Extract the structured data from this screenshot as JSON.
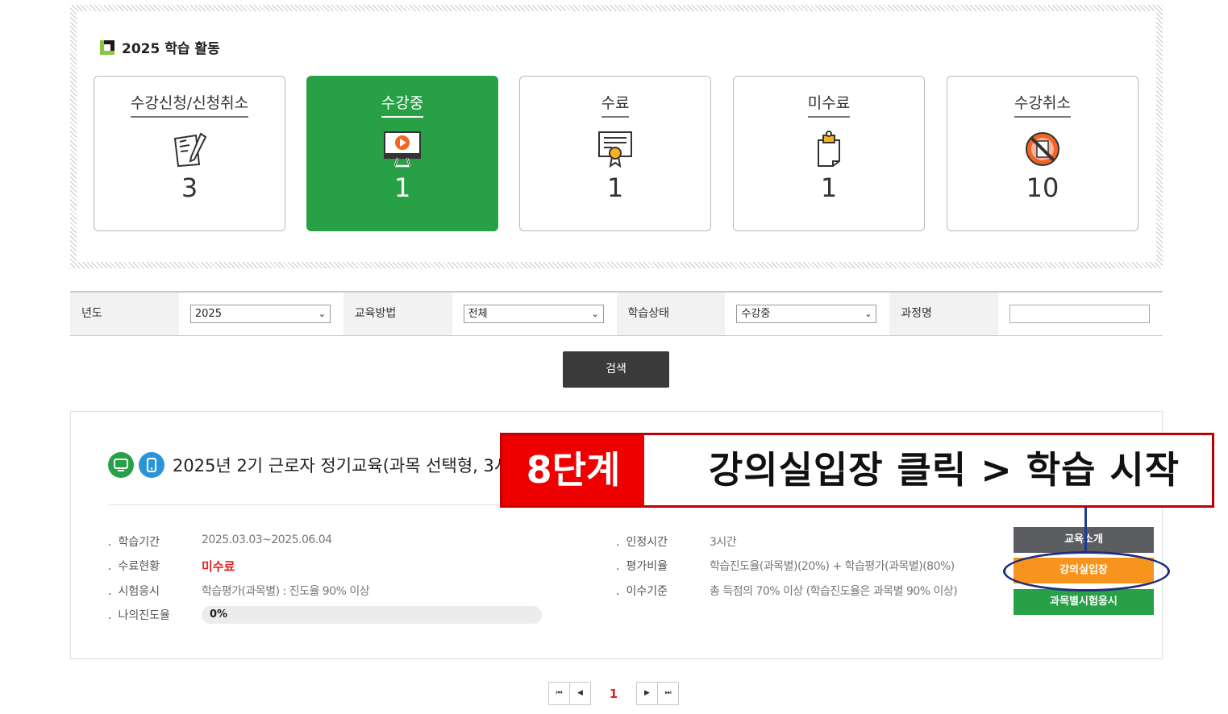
{
  "summary": {
    "title": "2025 학습 활동",
    "cards": [
      {
        "label": "수강신청/신청취소",
        "count": "3",
        "icon": "application-form-icon"
      },
      {
        "label": "수강중",
        "count": "1",
        "icon": "video-lecture-icon"
      },
      {
        "label": "수료",
        "count": "1",
        "icon": "certificate-icon"
      },
      {
        "label": "미수료",
        "count": "1",
        "icon": "clipboard-icon"
      },
      {
        "label": "수강취소",
        "count": "10",
        "icon": "cancel-icon"
      }
    ]
  },
  "filters": {
    "year_label": "년도",
    "year_value": "2025",
    "method_label": "교육방법",
    "method_value": "전체",
    "status_label": "학습상태",
    "status_value": "수강중",
    "course_label": "과정명",
    "course_value": "",
    "search_label": "검색"
  },
  "course": {
    "title": "2025년 2기 근로자 정기교육(과목 선택형, 3시",
    "period_label": "학습기간",
    "period_value": "2025.03.03~2025.06.04",
    "completion_label": "수료현황",
    "completion_value": "미수료",
    "exam_label": "시험응시",
    "exam_value": "학습평가(과목별) : 진도율 90% 이상",
    "progress_label": "나의진도율",
    "progress_value": "0%",
    "progress_fraction": 0,
    "hours_label": "인정시간",
    "hours_value": "3시간",
    "ratio_label": "평가비율",
    "ratio_value": "학습진도율(과목별)(20%) + 학습평가(과목별)(80%)",
    "criteria_label": "이수기준",
    "criteria_value": "총 득점의 70% 이상 (학습진도율은 과목별 90% 이상)",
    "btn_intro": "교육소개",
    "btn_enter": "강의실입장",
    "btn_exam": "과목별시험응시"
  },
  "annotation": {
    "step": "8단계",
    "text": "강의실입장 클릭 > 학습 시작"
  },
  "pagination": {
    "first": "⏮",
    "prev": "◀",
    "current": "1",
    "next": "▶",
    "last": "⏭"
  },
  "colors": {
    "accent_green": "#27a046",
    "accent_orange": "#f7941d",
    "annotation_red": "#ee0000",
    "annotation_navy": "#1f2f7a"
  }
}
